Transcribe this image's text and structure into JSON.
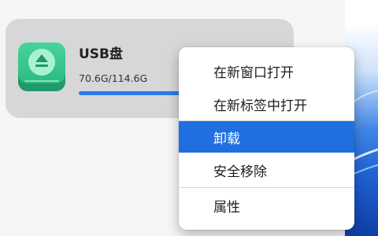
{
  "device": {
    "name": "USB盘",
    "usage_text": "70.6G/114.6G",
    "used_fraction": 0.616,
    "icon": "usb-drive-icon"
  },
  "context_menu": {
    "items": [
      {
        "label": "在新窗口打开"
      },
      {
        "label": "在新标签中打开"
      },
      {
        "label": "卸载",
        "highlighted": true
      },
      {
        "label": "安全移除"
      },
      {
        "label": "属性"
      }
    ]
  },
  "colors": {
    "accent": "#1f6fe0",
    "progress": "#2a7ae9",
    "drive_icon": "#28b57c",
    "card_bg": "#d7d7d9"
  }
}
